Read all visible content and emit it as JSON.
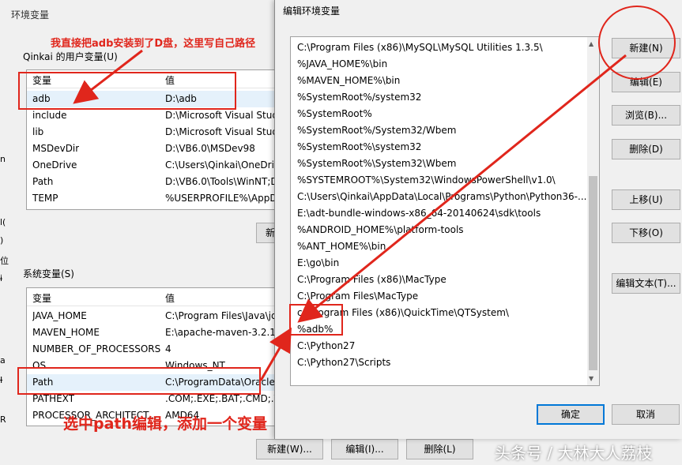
{
  "bg_window": {
    "title": "环境变量",
    "user_group_label": "Qinkai 的用户变量(U)",
    "user_headers": {
      "name": "变量",
      "value": "值"
    },
    "user_vars": [
      {
        "name": "adb",
        "value": "D:\\adb"
      },
      {
        "name": "include",
        "value": "D:\\Microsoft Visual Studi"
      },
      {
        "name": "lib",
        "value": "D:\\Microsoft Visual Studi"
      },
      {
        "name": "MSDevDir",
        "value": "D:\\VB6.0\\MSDev98"
      },
      {
        "name": "OneDrive",
        "value": "C:\\Users\\Qinkai\\OneDriv"
      },
      {
        "name": "Path",
        "value": "D:\\VB6.0\\Tools\\WinNT;D"
      },
      {
        "name": "TEMP",
        "value": "%USERPROFILE%\\AppDa"
      }
    ],
    "user_new_button": "新",
    "sys_group_label": "系统变量(S)",
    "sys_headers": {
      "name": "变量",
      "value": "值"
    },
    "sys_vars": [
      {
        "name": "JAVA_HOME",
        "value": "C:\\Program Files\\Java\\jd"
      },
      {
        "name": "MAVEN_HOME",
        "value": "E:\\apache-maven-3.2.1"
      },
      {
        "name": "NUMBER_OF_PROCESSORS",
        "value": "4"
      },
      {
        "name": "OS",
        "value": "Windows_NT"
      },
      {
        "name": "Path",
        "value": "C:\\ProgramData\\Oracle"
      },
      {
        "name": "PATHEXT",
        "value": ".COM;.EXE;.BAT;.CMD;.V"
      },
      {
        "name": "PROCESSOR_ARCHITECT...",
        "value": "AMD64"
      }
    ],
    "buttons": {
      "new": "新建(W)...",
      "edit": "编辑(I)...",
      "delete": "删除(L)"
    },
    "edge_glyphs": [
      "n",
      "l(",
      ")",
      "位",
      "ɨ",
      "a",
      "Ɨ",
      "R"
    ]
  },
  "dialog": {
    "title": "编辑环境变量",
    "paths": [
      "C:\\Program Files (x86)\\MySQL\\MySQL Utilities 1.3.5\\",
      "%JAVA_HOME%\\bin",
      "%MAVEN_HOME%\\bin",
      "%SystemRoot%/system32",
      "%SystemRoot%",
      "%SystemRoot%/System32/Wbem",
      "%SystemRoot%\\system32",
      "%SystemRoot%\\System32\\Wbem",
      "%SYSTEMROOT%\\System32\\WindowsPowerShell\\v1.0\\",
      "C:\\Users\\Qinkai\\AppData\\Local\\Programs\\Python\\Python36-...",
      "E:\\adt-bundle-windows-x86_64-20140624\\sdk\\tools",
      "%ANDROID_HOME%\\platform-tools",
      "%ANT_HOME%\\bin",
      "E:\\go\\bin",
      "C:\\Program Files (x86)\\MacType",
      "C:\\Program Files\\MacType",
      "c:\\Program Files (x86)\\QuickTime\\QTSystem\\",
      "%adb%",
      "C:\\Python27",
      "C:\\Python27\\Scripts"
    ],
    "buttons": {
      "new": "新建(N)",
      "edit": "编辑(E)",
      "browse": "浏览(B)...",
      "delete": "删除(D)",
      "move_up": "上移(U)",
      "move_down": "下移(O)",
      "edit_text": "编辑文本(T)...",
      "ok": "确定",
      "cancel": "取消"
    }
  },
  "annotations": {
    "top": "我直接把adb安装到了D盘，这里写自己路径",
    "bottom": "选中path编辑，添加一个变量"
  },
  "watermark": "头条号 / 大林大人荔枝",
  "colors": {
    "annotation_red": "#e0261c",
    "selection": "#e5f1fb",
    "accent": "#0078d7"
  }
}
